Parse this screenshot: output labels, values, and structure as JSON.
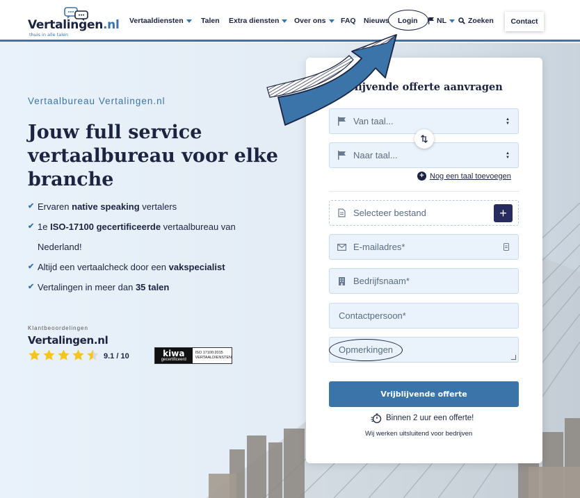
{
  "header": {
    "logo": {
      "name": "Vertalingen",
      "tld": ".nl",
      "tagline": "thuis in alle talen"
    },
    "nav": [
      {
        "label": "Vertaaldiensten",
        "dropdown": true
      },
      {
        "label": "Talen",
        "dropdown": false
      },
      {
        "label": "Extra diensten",
        "dropdown": true
      },
      {
        "label": "Over ons",
        "dropdown": true
      },
      {
        "label": "FAQ",
        "dropdown": false
      },
      {
        "label": "Nieuws",
        "dropdown": false
      },
      {
        "label": "Login",
        "dropdown": false
      }
    ],
    "language": "NL",
    "search_label": "Zoeken",
    "contact_label": "Contact"
  },
  "hero": {
    "eyebrow": "Vertaalbureau Vertalingen.nl",
    "title": "Jouw full service vertaalbureau voor elke branche",
    "usps": [
      {
        "pre": "Ervaren ",
        "bold": "native speaking",
        "post": " vertalers"
      },
      {
        "pre": "1e ",
        "bold": "ISO-17100 gecertificeerde",
        "post": " vertaalbureau van Nederland!"
      },
      {
        "pre": "Altijd een vertaalcheck door een ",
        "bold": "vakspecialist",
        "post": ""
      },
      {
        "pre": "Vertalingen in meer dan ",
        "bold": "35 talen",
        "post": ""
      }
    ]
  },
  "reviews": {
    "label": "Klantbeoordelingen",
    "brand": "Vertalingen.nl",
    "rating": 4.5,
    "score_text": "9.1 / 10",
    "cert": {
      "name": "kiwa",
      "sub": "gecertificeerd",
      "line1": "ISO 17100:2015",
      "line2": "VERTAALDIENSTEN"
    }
  },
  "form": {
    "title": "Vrijblijvende offerte aanvragen",
    "from_placeholder": "Van taal...",
    "to_placeholder": "Naar taal...",
    "add_language": "Nog een taal toevoegen",
    "file_placeholder": "Selecteer bestand",
    "email_placeholder": "E-mailadres*",
    "company_placeholder": "Bedrijfsnaam*",
    "contact_placeholder": "Contactpersoon*",
    "remarks_placeholder": "Opmerkingen",
    "submit_label": "Vrijblijvende offerte",
    "promise": "Binnen 2 uur een offerte!",
    "b2b_note": "Wij werken uitsluitend voor bedrijven"
  },
  "colors": {
    "primary": "#3a74a9",
    "navy": "#1b2440",
    "button_dark": "#282b5e",
    "star": "#f5c518"
  }
}
